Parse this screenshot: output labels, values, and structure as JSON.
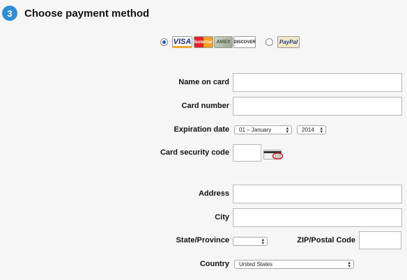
{
  "header": {
    "step_number": "3",
    "title": "Choose payment method"
  },
  "payment_options": {
    "cards": [
      "VISA",
      "MasterCard",
      "AMEX",
      "DISCOVER"
    ],
    "paypal": "PayPal",
    "selected": "cards"
  },
  "form": {
    "name_on_card_label": "Name on card",
    "card_number_label": "Card number",
    "expiration_date_label": "Expiration date",
    "expiration_month": "01 – January",
    "expiration_year": "2014",
    "card_security_code_label": "Card security code",
    "cvv_sample": "123",
    "address_label": "Address",
    "city_label": "City",
    "state_label": "State/Province",
    "state_value": "",
    "zip_label": "ZIP/Postal Code",
    "country_label": "Country",
    "country_value": "United States"
  }
}
